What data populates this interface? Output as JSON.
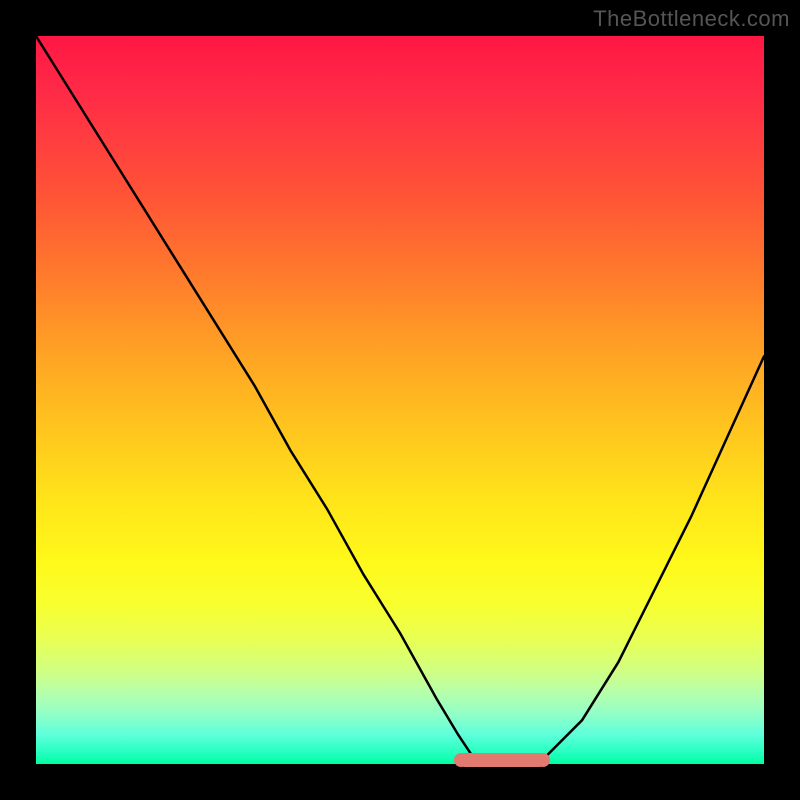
{
  "watermark": "TheBottleneck.com",
  "chart_data": {
    "type": "line",
    "title": "",
    "xlabel": "",
    "ylabel": "",
    "xlim": [
      0,
      100
    ],
    "ylim": [
      0,
      100
    ],
    "x": [
      0,
      5,
      10,
      15,
      20,
      25,
      30,
      35,
      40,
      45,
      50,
      55,
      58,
      60,
      63,
      66,
      70,
      75,
      80,
      85,
      90,
      95,
      100
    ],
    "values": [
      100,
      92,
      84,
      76,
      68,
      60,
      52,
      43,
      35,
      26,
      18,
      9,
      4,
      1,
      0,
      0,
      1,
      6,
      14,
      24,
      34,
      45,
      56
    ],
    "series": [
      {
        "name": "bottleneck-curve",
        "color": "#000000"
      }
    ],
    "highlight_band": {
      "x_start": 58,
      "x_end": 70,
      "y": 0.5,
      "color": "#e17a6f"
    },
    "background": {
      "type": "vertical-gradient",
      "stops": [
        {
          "pos": 0,
          "color": "#ff1744"
        },
        {
          "pos": 50,
          "color": "#ffd21a"
        },
        {
          "pos": 100,
          "color": "#00ff9c"
        }
      ]
    }
  }
}
